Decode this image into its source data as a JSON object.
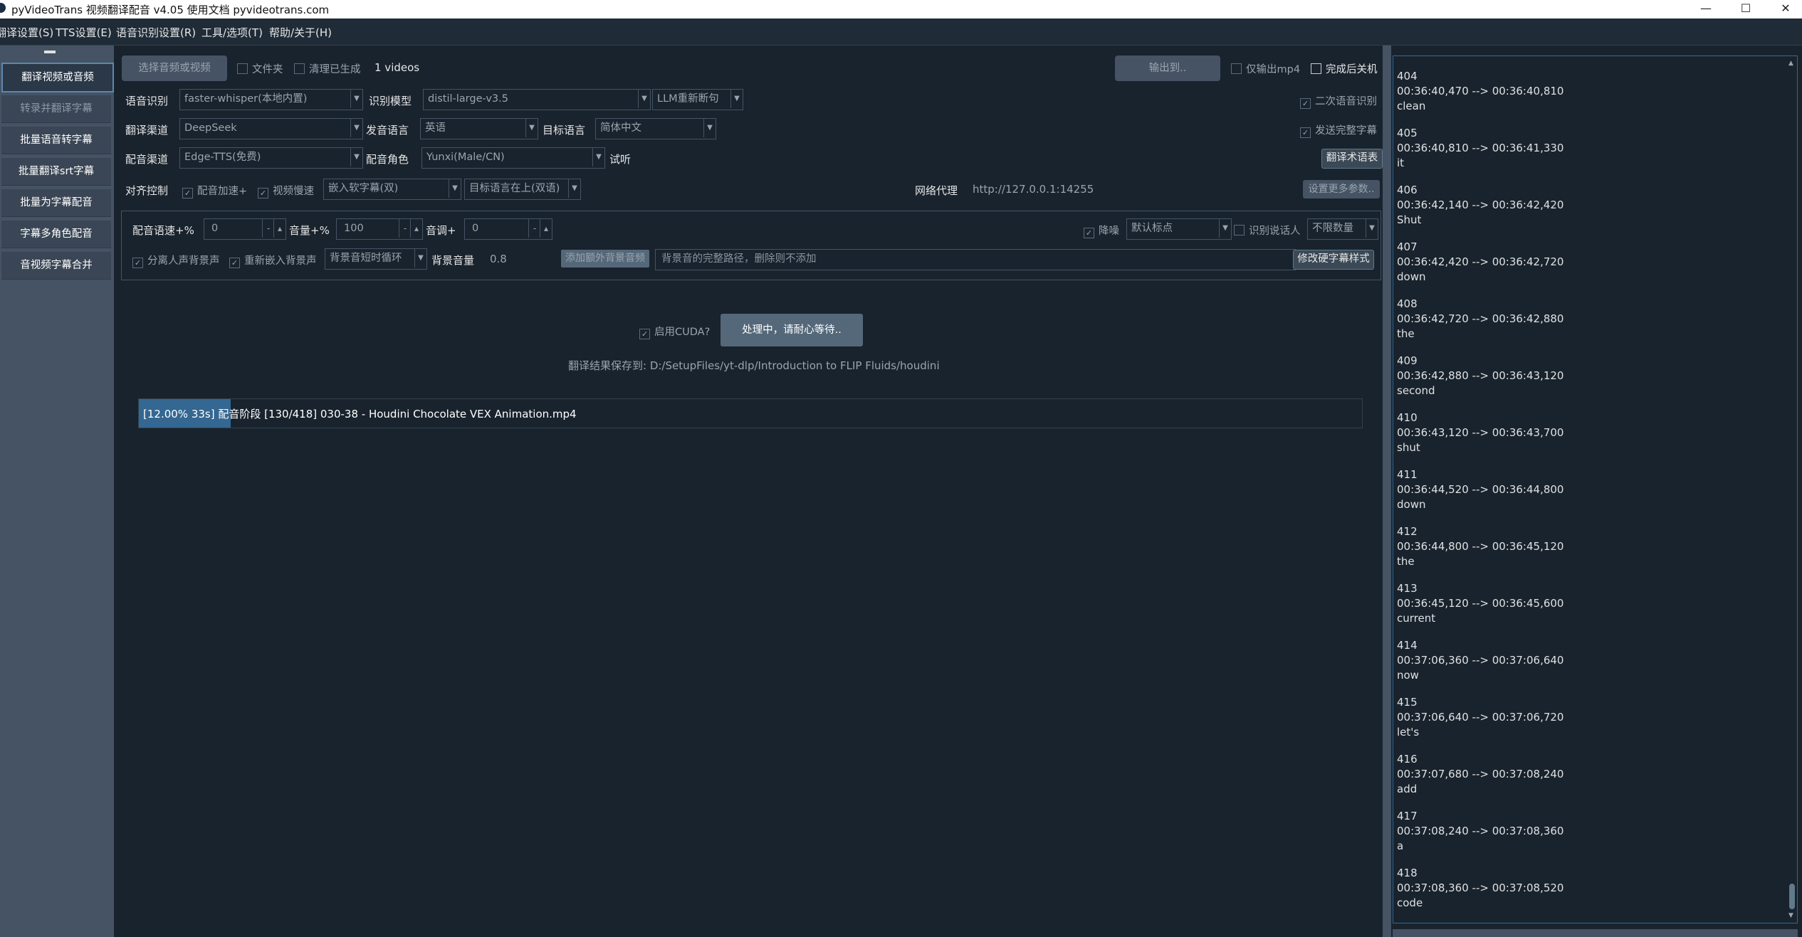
{
  "window": {
    "title": "pyVideoTrans 视频翻译配音 v4.05  使用文档 pyvideotrans.com",
    "minimize": "—",
    "maximize": "☐",
    "close": "✕"
  },
  "menu": [
    "翻译设置(S)",
    "TTS设置(E)",
    "语音识别设置(R)",
    "工具/选项(T)",
    "帮助/关于(H)"
  ],
  "sidebar": {
    "items": [
      {
        "label": "翻译视频或音频",
        "state": "active"
      },
      {
        "label": "转录并翻译字幕",
        "state": "disabled"
      },
      {
        "label": "批量语音转字幕",
        "state": "normal"
      },
      {
        "label": "批量翻译srt字幕",
        "state": "normal"
      },
      {
        "label": "批量为字幕配音",
        "state": "normal"
      },
      {
        "label": "字幕多角色配音",
        "state": "normal"
      },
      {
        "label": "音视频字幕合并",
        "state": "normal"
      }
    ]
  },
  "toolbar": {
    "select_button": "选择音频或视频",
    "folder_check": "文件夹",
    "clean_check": "清理已生成",
    "video_count": "1 videos",
    "output_button": "输出到..",
    "only_mp4": "仅输出mp4",
    "shutdown": "完成后关机"
  },
  "row1": {
    "asr_label": "语音识别",
    "asr_value": "faster-whisper(本地内置)",
    "model_label": "识别模型",
    "model_value": "distil-large-v3.5",
    "llm_value": "LLM重新断句",
    "second_asr": "二次语音识别"
  },
  "row2": {
    "trans_label": "翻译渠道",
    "trans_value": "DeepSeek",
    "src_label": "发音语言",
    "src_value": "英语",
    "tgt_label": "目标语言",
    "tgt_value": "简体中文",
    "send_full": "发送完整字幕"
  },
  "row3": {
    "tts_label": "配音渠道",
    "tts_value": "Edge-TTS(免费)",
    "role_label": "配音角色",
    "role_value": "Yunxi(Male/CN)",
    "listen": "试听",
    "glossary_button": "翻译术语表"
  },
  "row4": {
    "align_label": "对齐控制",
    "speed_up": "配音加速+",
    "slow_video": "视频慢速",
    "embed_value": "嵌入软字幕(双)",
    "lang_pos_value": "目标语言在上(双语)",
    "proxy_label": "网络代理",
    "proxy_value": "http://127.0.0.1:14255",
    "more_button": "设置更多参数.."
  },
  "params": {
    "rate_label": "配音语速+%",
    "rate_value": "0",
    "volume_label": "音量+%",
    "volume_value": "100",
    "pitch_label": "音调+",
    "pitch_value": "0",
    "denoise": "降噪",
    "punct_value": "默认标点",
    "speaker_id": "识别说话人",
    "speaker_count": "不限数量",
    "separate_bg": "分离人声背景声",
    "reembed_bg": "重新嵌入背景声",
    "bg_loop_value": "背景音短时循环",
    "bg_volume_label": "背景音量",
    "bg_volume_value": "0.8",
    "add_bg_button": "添加额外背景音频",
    "bg_path_placeholder": "背景音的完整路径，删除则不添加",
    "sub_style_button": "修改硬字幕样式"
  },
  "action": {
    "cuda": "启用CUDA?",
    "process_button": "处理中，请耐心等待..",
    "save_path": "翻译结果保存到:  D:/SetupFiles/yt-dlp/Introduction to FLIP Fluids/houdini"
  },
  "progress": {
    "text": "[12.00%  33s]  配音阶段 [130/418] 030-38 - Houdini Chocolate VEX Animation.mp4",
    "percent": 12.0
  },
  "log": [
    {
      "index": "404",
      "time": "00:36:40,470 --> 00:36:40,810",
      "text": "clean"
    },
    {
      "index": "405",
      "time": "00:36:40,810 --> 00:36:41,330",
      "text": "it"
    },
    {
      "index": "406",
      "time": "00:36:42,140 --> 00:36:42,420",
      "text": "Shut"
    },
    {
      "index": "407",
      "time": "00:36:42,420 --> 00:36:42,720",
      "text": "down"
    },
    {
      "index": "408",
      "time": "00:36:42,720 --> 00:36:42,880",
      "text": "the"
    },
    {
      "index": "409",
      "time": "00:36:42,880 --> 00:36:43,120",
      "text": "second"
    },
    {
      "index": "410",
      "time": "00:36:43,120 --> 00:36:43,700",
      "text": "shut"
    },
    {
      "index": "411",
      "time": "00:36:44,520 --> 00:36:44,800",
      "text": "down"
    },
    {
      "index": "412",
      "time": "00:36:44,800 --> 00:36:45,120",
      "text": "the"
    },
    {
      "index": "413",
      "time": "00:36:45,120 --> 00:36:45,600",
      "text": "current"
    },
    {
      "index": "414",
      "time": "00:37:06,360 --> 00:37:06,640",
      "text": "now"
    },
    {
      "index": "415",
      "time": "00:37:06,640 --> 00:37:06,720",
      "text": "let's"
    },
    {
      "index": "416",
      "time": "00:37:07,680 --> 00:37:08,240",
      "text": "add"
    },
    {
      "index": "417",
      "time": "00:37:08,240 --> 00:37:08,360",
      "text": "a"
    },
    {
      "index": "418",
      "time": "00:37:08,360 --> 00:37:08,520",
      "text": "code"
    }
  ],
  "colors": {
    "background": "#19232d",
    "sidebar": "#455364",
    "accent": "#346792",
    "text": "#dfe1e2"
  }
}
